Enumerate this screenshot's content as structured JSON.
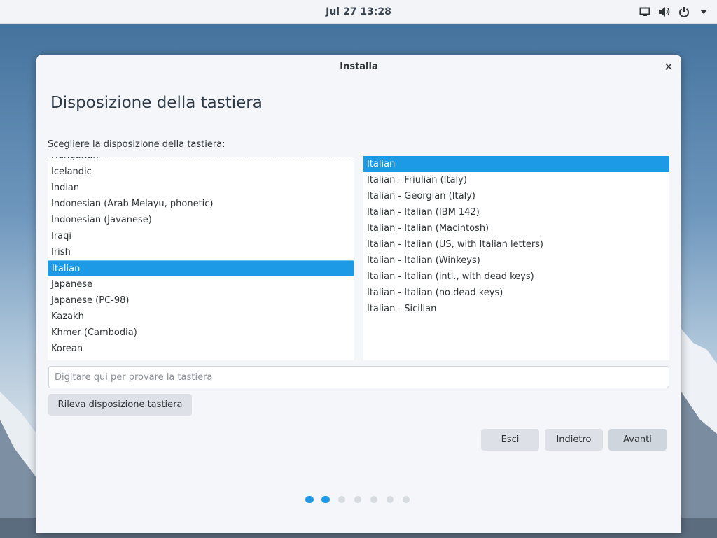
{
  "topbar": {
    "clock": "Jul 27  13:28",
    "icons": [
      "display-icon",
      "volume-icon",
      "power-icon",
      "chevron-down-icon"
    ]
  },
  "dialog": {
    "title": "Installa",
    "heading": "Disposizione della tastiera",
    "prompt": "Scegliere la disposizione della tastiera:",
    "layouts": [
      "Hungarian",
      "Icelandic",
      "Indian",
      "Indonesian (Arab Melayu, phonetic)",
      "Indonesian (Javanese)",
      "Iraqi",
      "Irish",
      "Italian",
      "Japanese",
      "Japanese (PC-98)",
      "Kazakh",
      "Khmer (Cambodia)",
      "Korean"
    ],
    "selected_layout": "Italian",
    "variants": [
      "Italian",
      "Italian - Friulian (Italy)",
      "Italian - Georgian (Italy)",
      "Italian - Italian (IBM 142)",
      "Italian - Italian (Macintosh)",
      "Italian - Italian (US, with Italian letters)",
      "Italian - Italian (Winkeys)",
      "Italian - Italian (intl., with dead keys)",
      "Italian - Italian (no dead keys)",
      "Italian - Sicilian"
    ],
    "selected_variant": "Italian",
    "test_placeholder": "Digitare qui per provare la tastiera",
    "detect_button": "Rileva disposizione tastiera",
    "quit_button": "Esci",
    "back_button": "Indietro",
    "next_button": "Avanti",
    "progress": {
      "total_steps": 7,
      "current_step": 2
    }
  },
  "colors": {
    "accent": "#1c9ae6",
    "dialog_bg": "#f4f6f9",
    "button_bg": "#dde1e7"
  }
}
